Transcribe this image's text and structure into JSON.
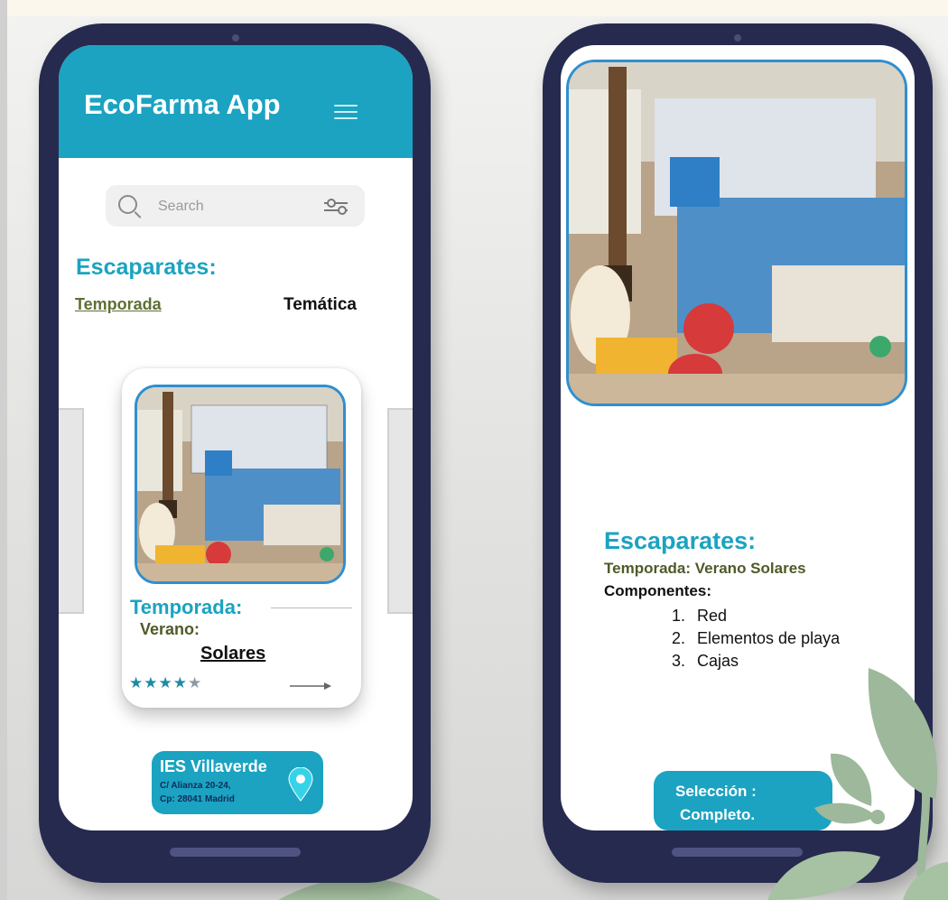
{
  "app": {
    "title": "EcoFarma App"
  },
  "search": {
    "placeholder": "Search"
  },
  "section": {
    "title": "Escaparates:"
  },
  "tabs": [
    {
      "label": "Temporada",
      "active": true
    },
    {
      "label": "Temática",
      "active": false
    }
  ],
  "card": {
    "title": "Temporada:",
    "subtitle": "Verano:",
    "item": "Solares",
    "rating": 4,
    "rating_max": 5
  },
  "location": {
    "name": "IES Villaverde",
    "address1": "C/ Alianza 20-24,",
    "address2": "Cp: 28041 Madrid"
  },
  "detail": {
    "title": "Escaparates:",
    "season": "Temporada: Verano Solares",
    "components_label": "Componentes:",
    "components": [
      {
        "num": "1.",
        "label": "Red"
      },
      {
        "num": "2.",
        "label": "Elementos de playa"
      },
      {
        "num": "3.",
        "label": "Cajas"
      }
    ],
    "selection_label": "Selección :",
    "selection_value": "Completo."
  },
  "colors": {
    "accent": "#1ba3c1",
    "phone_frame": "#262a4f",
    "olive_text": "#4d5b27",
    "leaf_green": "#9db89a",
    "photo_border": "#2f8fcf"
  },
  "icons": {
    "menu": "hamburger-menu-icon",
    "search": "magnifier-icon",
    "filter": "slider-filter-icon",
    "arrow": "arrow-right-icon",
    "pin": "map-pin-icon",
    "star": "star-icon"
  }
}
